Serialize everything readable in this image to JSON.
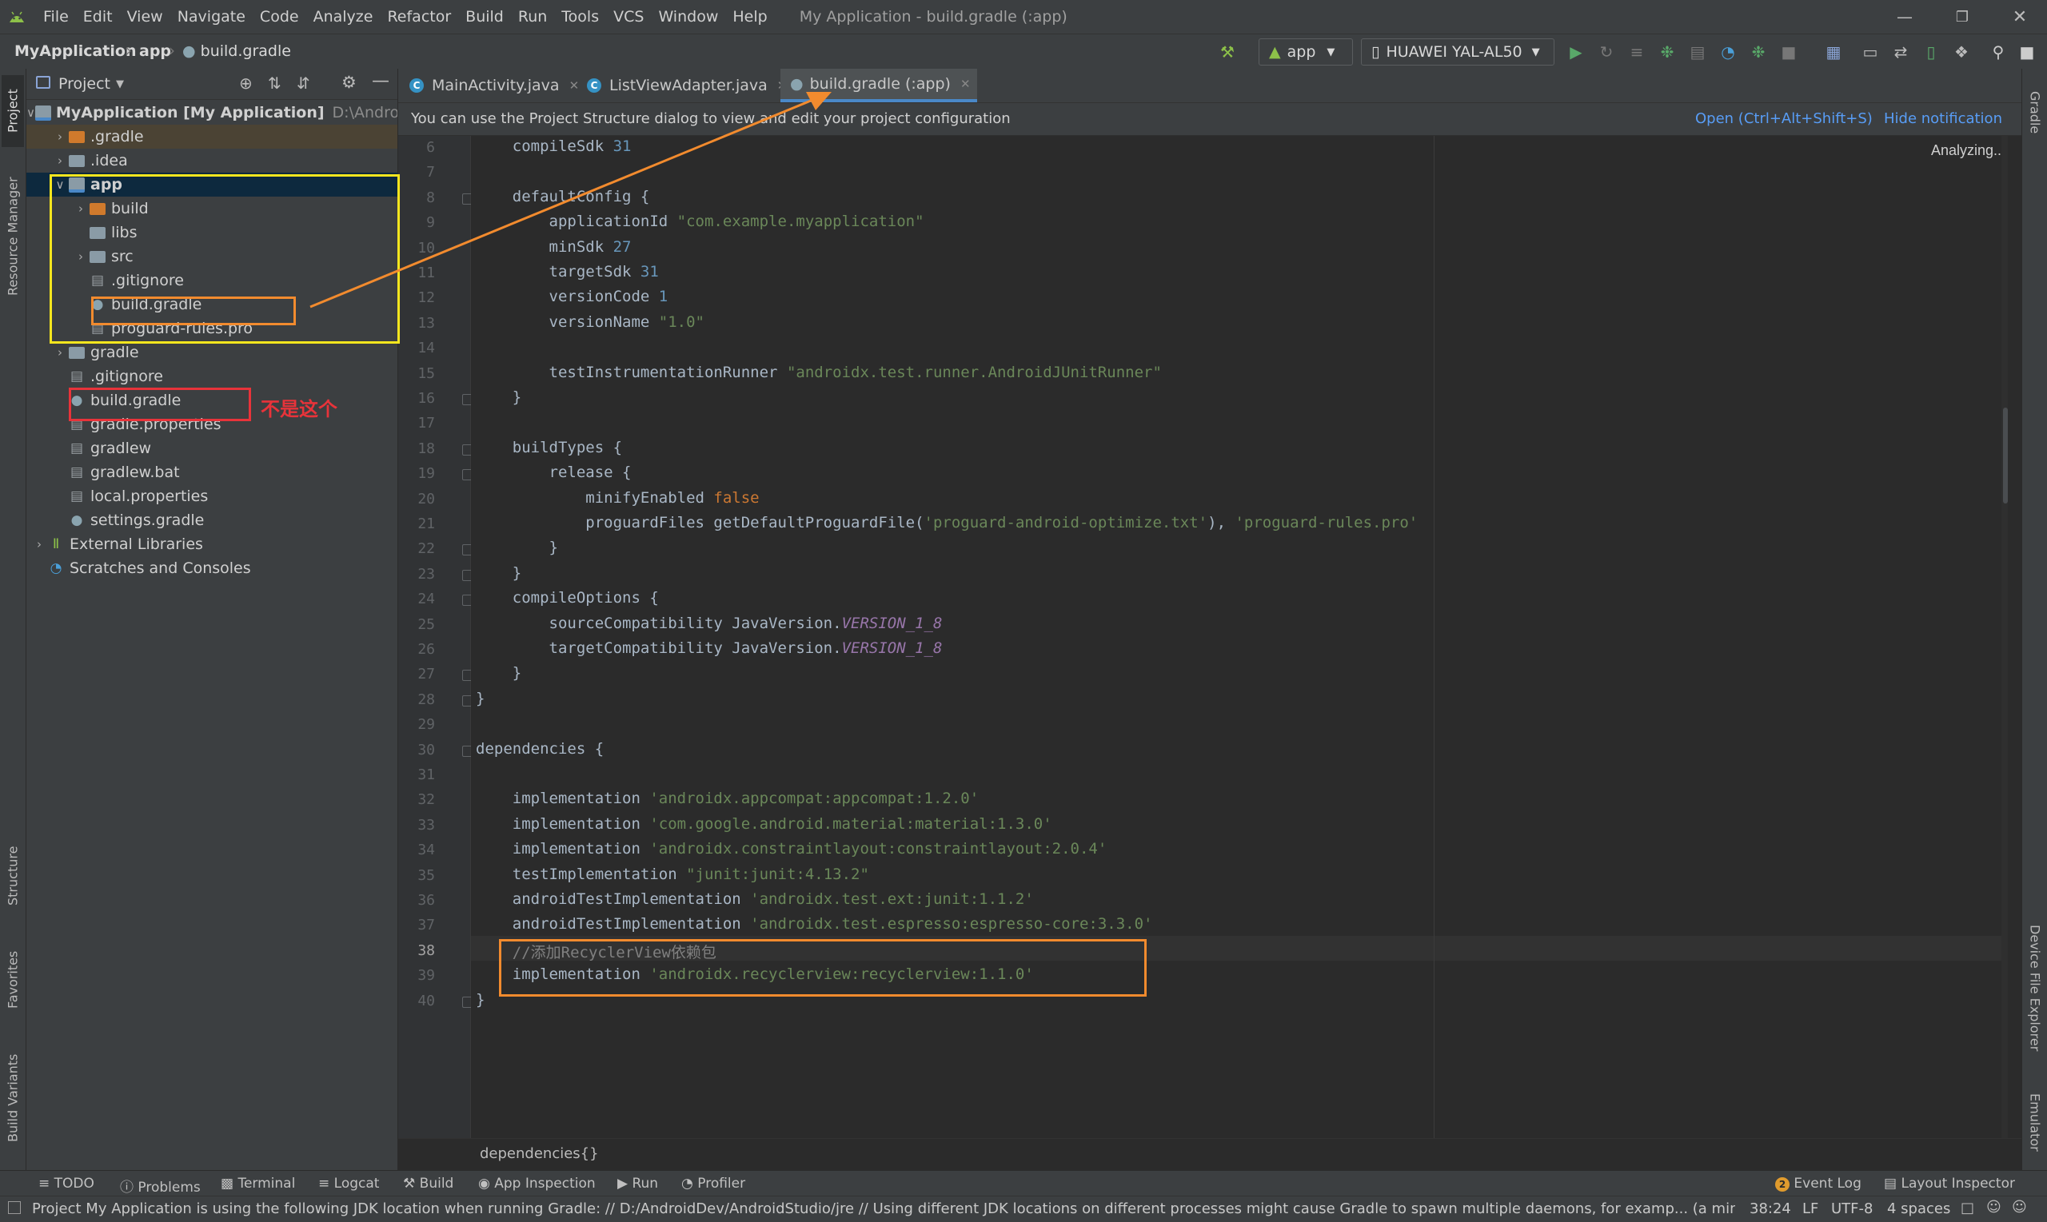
{
  "menubar": {
    "items": [
      "File",
      "Edit",
      "View",
      "Navigate",
      "Code",
      "Analyze",
      "Refactor",
      "Build",
      "Run",
      "Tools",
      "VCS",
      "Window",
      "Help"
    ],
    "window_title": "My Application - build.gradle (:app)"
  },
  "navbar": {
    "breadcrumb": [
      "MyApplication",
      "app",
      "build.gradle"
    ],
    "run_config": "app",
    "device": "HUAWEI YAL-AL50"
  },
  "project_panel": {
    "view_selector": "Project",
    "tree": [
      {
        "label": "MyApplication [My Application]",
        "suffix": "D:\\AndroidD",
        "level": 0,
        "arrow": "down",
        "icon": "module"
      },
      {
        "label": ".gradle",
        "level": 1,
        "arrow": "right",
        "icon": "folder-orange"
      },
      {
        "label": ".idea",
        "level": 1,
        "arrow": "right",
        "icon": "folder"
      },
      {
        "label": "app",
        "level": 1,
        "arrow": "down",
        "icon": "module"
      },
      {
        "label": "build",
        "level": 2,
        "arrow": "right",
        "icon": "folder-orange"
      },
      {
        "label": "libs",
        "level": 2,
        "arrow": "",
        "icon": "folder"
      },
      {
        "label": "src",
        "level": 2,
        "arrow": "right",
        "icon": "folder"
      },
      {
        "label": ".gitignore",
        "level": 2,
        "arrow": "",
        "icon": "file"
      },
      {
        "label": "build.gradle",
        "level": 2,
        "arrow": "",
        "icon": "gradle"
      },
      {
        "label": "proguard-rules.pro",
        "level": 2,
        "arrow": "",
        "icon": "file"
      },
      {
        "label": "gradle",
        "level": 1,
        "arrow": "right",
        "icon": "folder"
      },
      {
        "label": ".gitignore",
        "level": 1,
        "arrow": "",
        "icon": "file"
      },
      {
        "label": "build.gradle",
        "level": 1,
        "arrow": "",
        "icon": "gradle"
      },
      {
        "label": "gradle.properties",
        "level": 1,
        "arrow": "",
        "icon": "file"
      },
      {
        "label": "gradlew",
        "level": 1,
        "arrow": "",
        "icon": "file"
      },
      {
        "label": "gradlew.bat",
        "level": 1,
        "arrow": "",
        "icon": "file"
      },
      {
        "label": "local.properties",
        "level": 1,
        "arrow": "",
        "icon": "file"
      },
      {
        "label": "settings.gradle",
        "level": 1,
        "arrow": "",
        "icon": "gradle"
      },
      {
        "label": "External Libraries",
        "level": 0,
        "arrow": "right",
        "icon": "library"
      },
      {
        "label": "Scratches and Consoles",
        "level": 0,
        "arrow": "",
        "icon": "scratch"
      }
    ]
  },
  "annotation": {
    "not_this_label": "不是这个"
  },
  "left_strip": [
    "Project",
    "Resource Manager",
    "Structure",
    "Favorites",
    "Build Variants"
  ],
  "right_strip": [
    "Gradle",
    "Device File Explorer",
    "Emulator"
  ],
  "tabs": [
    {
      "label": "MainActivity.java",
      "active": false
    },
    {
      "label": "ListViewAdapter.java",
      "active": false
    },
    {
      "label": "build.gradle (:app)",
      "active": true
    }
  ],
  "notification": {
    "text": "You can use the Project Structure dialog to view and edit your project configuration",
    "open_link": "Open (Ctrl+Alt+Shift+S)",
    "hide_link": "Hide notification"
  },
  "editor": {
    "status": "Analyzing...",
    "line_numbers": [
      "6",
      "7",
      "8",
      "9",
      "10",
      "11",
      "12",
      "13",
      "14",
      "15",
      "16",
      "17",
      "18",
      "19",
      "20",
      "21",
      "22",
      "23",
      "24",
      "25",
      "26",
      "27",
      "28",
      "29",
      "30",
      "31",
      "32",
      "33",
      "34",
      "35",
      "36",
      "37",
      "38",
      "39",
      "40"
    ],
    "lines": [
      [
        {
          "t": "    compileSdk "
        },
        {
          "t": "31",
          "c": "n"
        }
      ],
      [],
      [
        {
          "t": "    defaultConfig {"
        }
      ],
      [
        {
          "t": "        applicationId "
        },
        {
          "t": "\"com.example.myapplication\"",
          "c": "s"
        }
      ],
      [
        {
          "t": "        minSdk "
        },
        {
          "t": "27",
          "c": "n"
        }
      ],
      [
        {
          "t": "        targetSdk "
        },
        {
          "t": "31",
          "c": "n"
        }
      ],
      [
        {
          "t": "        versionCode "
        },
        {
          "t": "1",
          "c": "n"
        }
      ],
      [
        {
          "t": "        versionName "
        },
        {
          "t": "\"1.0\"",
          "c": "s"
        }
      ],
      [],
      [
        {
          "t": "        testInstrumentationRunner "
        },
        {
          "t": "\"androidx.test.runner.AndroidJUnitRunner\"",
          "c": "s"
        }
      ],
      [
        {
          "t": "    }"
        }
      ],
      [],
      [
        {
          "t": "    buildTypes {"
        }
      ],
      [
        {
          "t": "        release {"
        }
      ],
      [
        {
          "t": "            minifyEnabled "
        },
        {
          "t": "false",
          "c": "k"
        }
      ],
      [
        {
          "t": "            proguardFiles getDefaultProguardFile("
        },
        {
          "t": "'proguard-android-optimize.txt'",
          "c": "s"
        },
        {
          "t": "), "
        },
        {
          "t": "'proguard-rules.pro'",
          "c": "s"
        }
      ],
      [
        {
          "t": "        }"
        }
      ],
      [
        {
          "t": "    }"
        }
      ],
      [
        {
          "t": "    compileOptions {"
        }
      ],
      [
        {
          "t": "        sourceCompatibility JavaVersion."
        },
        {
          "t": "VERSION_1_8",
          "c": "i"
        }
      ],
      [
        {
          "t": "        targetCompatibility JavaVersion."
        },
        {
          "t": "VERSION_1_8",
          "c": "i"
        }
      ],
      [
        {
          "t": "    }"
        }
      ],
      [
        {
          "t": "}"
        }
      ],
      [],
      [
        {
          "t": "dependencies {"
        }
      ],
      [],
      [
        {
          "t": "    implementation "
        },
        {
          "t": "'androidx.appcompat:appcompat:1.2.0'",
          "c": "s"
        }
      ],
      [
        {
          "t": "    implementation "
        },
        {
          "t": "'com.google.android.material:material:1.3.0'",
          "c": "s"
        }
      ],
      [
        {
          "t": "    implementation "
        },
        {
          "t": "'androidx.constraintlayout:constraintlayout:2.0.4'",
          "c": "s"
        }
      ],
      [
        {
          "t": "    testImplementation "
        },
        {
          "t": "\"junit:junit:4.13.2\"",
          "c": "s"
        }
      ],
      [
        {
          "t": "    androidTestImplementation "
        },
        {
          "t": "'androidx.test.ext:junit:1.1.2'",
          "c": "s"
        }
      ],
      [
        {
          "t": "    androidTestImplementation "
        },
        {
          "t": "'androidx.test.espresso:espresso-core:3.3.0'",
          "c": "s"
        }
      ],
      [
        {
          "t": "    //添加RecyclerView依赖包",
          "c": "cm"
        }
      ],
      [
        {
          "t": "    implementation "
        },
        {
          "t": "'androidx.recyclerview:recyclerview:1.1.0'",
          "c": "s"
        }
      ],
      [
        {
          "t": "}"
        }
      ]
    ],
    "breadcrumb": "dependencies{}"
  },
  "tool_windows": [
    "TODO",
    "Problems",
    "Terminal",
    "Logcat",
    "Build",
    "App Inspection",
    "Run",
    "Profiler"
  ],
  "tool_windows_right": [
    "Event Log",
    "Layout Inspector"
  ],
  "event_log_count": "2",
  "status_bar": {
    "message": "Project My Application is using the following JDK location when running Gradle: // D:/AndroidDev/AndroidStudio/jre // Using different JDK locations on different processes might cause Gradle to spawn multiple daemons, for examp... (a minute a",
    "position": "38:24",
    "line_sep": "LF",
    "encoding": "UTF-8",
    "indent": "4 spaces"
  },
  "colors": {
    "accent": "#589df6",
    "annotation_yellow": "#f6e61e",
    "annotation_orange": "#f28b2e",
    "annotation_red": "#e8333a"
  }
}
